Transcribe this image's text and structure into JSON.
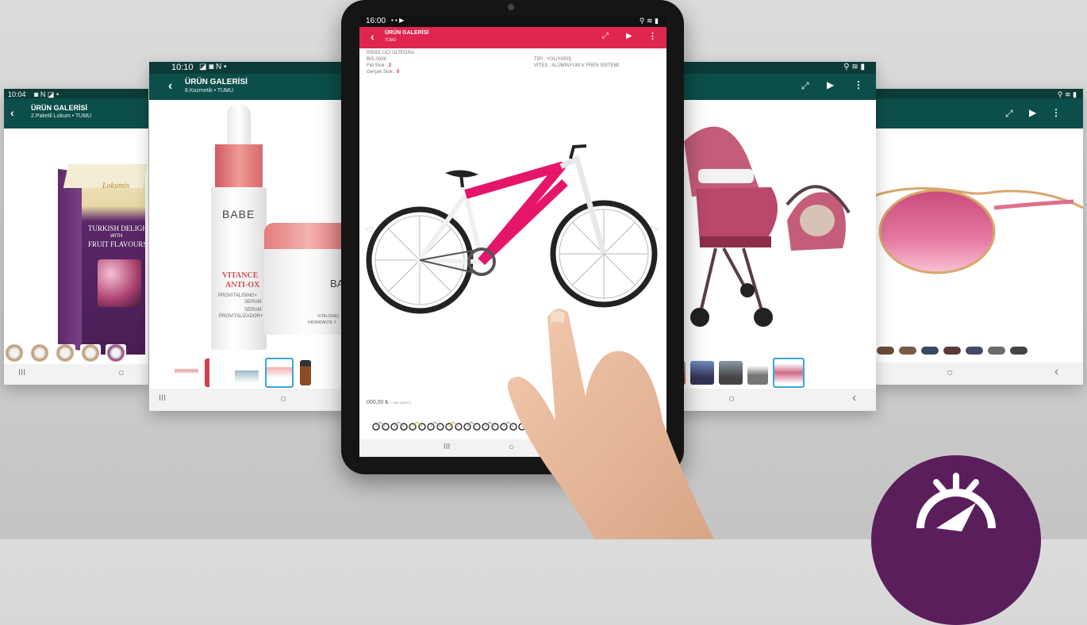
{
  "screen1": {
    "time": "10:04",
    "status_icons": "◙ N ◪ •",
    "title": "ÜRÜN GALERİSİ",
    "subtitle": "2.Paketli Lokum • TÜMÜ",
    "product": {
      "brand": "Lokumix",
      "line1": "TURKISH DELIGHT",
      "line2": "WITH",
      "line3": "FRUIT FLAVOURS"
    },
    "nav": {
      "recent": "III",
      "home": "○"
    }
  },
  "screen2": {
    "time": "10:10",
    "status_icons": "◪ ◙ N •",
    "title": "ÜRÜN GALERİSİ",
    "subtitle": "8.Kozmetik • TÜMÜ",
    "product": {
      "brand": "BABE",
      "name1": "VITANCE",
      "name2": "ANTI-OX",
      "desc1": "PROVITALISING+",
      "desc2": "SERUM",
      "desc3": "SÉRUM",
      "desc4": "PROVITALIZADOR+",
      "jar_brand": "BA",
      "jar_text1": "VITALISING",
      "jar_text2": "HIDRATANTE Y"
    },
    "nav": {
      "recent": "III",
      "home": "○"
    }
  },
  "screen3": {
    "time": "16:00",
    "status_icons": "▪ ▪ ▶",
    "right_icons": "⚲ ≋ ▮",
    "title": "ÜRÜN GALERİSİ",
    "subtitle": "TÜMÜ",
    "info_left": [
      "RS001 UCI ULTEGRA",
      "BIS.0008"
    ],
    "fiili_label": "Fiili Stok :",
    "fiili_value": "2",
    "gercek_label": "Gerçek Stok :",
    "gercek_value": "0",
    "info_right": [
      "TİPİ : YOL/YARIŞ",
      "VİTES : ALÜMİNYUM V FREN SİSTEMİ"
    ],
    "price": "000,00 ₺",
    "price_suffix": "+ KDV (ADET)",
    "nav": {
      "recent": "III",
      "home": "○"
    }
  },
  "screen4": {
    "status_icons": "⚲ ≋ ▮",
    "nav": {
      "home": "○",
      "back": "‹"
    }
  },
  "screen5": {
    "status_icons": "⚲ ≋ ▮",
    "nav": {
      "home": "○",
      "back": "‹"
    }
  },
  "colors": {
    "teal": "#0c4e49",
    "pink": "#e0264f",
    "purple": "#5a1e5b"
  }
}
